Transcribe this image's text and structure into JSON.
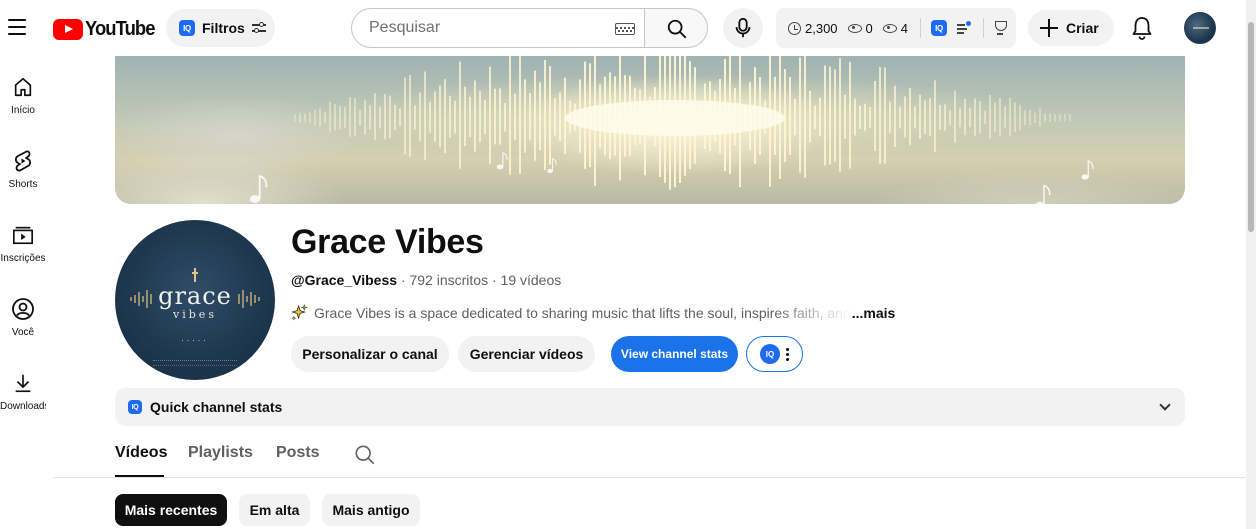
{
  "header": {
    "logo_text": "YouTube",
    "filters_label": "Filtros",
    "search_placeholder": "Pesquisar",
    "ext": {
      "iq": "IQ",
      "views_total": "2,300",
      "views_a": "0",
      "views_b": "4"
    },
    "create_label": "Criar"
  },
  "sidebar": {
    "items": [
      {
        "label": "Início",
        "icon": "home-icon"
      },
      {
        "label": "Shorts",
        "icon": "shorts-icon"
      },
      {
        "label": "Inscrições",
        "icon": "subscriptions-icon"
      },
      {
        "label": "Você",
        "icon": "you-icon"
      },
      {
        "label": "Downloads",
        "icon": "download-icon"
      }
    ]
  },
  "channel": {
    "avatar_word1": "grace",
    "avatar_word2": "vibes",
    "avatar_dots": ".....",
    "name": "Grace Vibes",
    "handle": "@Grace_Vibess",
    "subscribers": "792 inscritos",
    "videos": "19 vídeos",
    "meta_sep": " · ",
    "description": "Grace Vibes is a space dedicated to sharing music that lifts the soul, inspires faith, and",
    "more_label": "...mais",
    "buttons": {
      "customize": "Personalizar o canal",
      "manage": "Gerenciar vídeos",
      "stats": "View channel stats",
      "iq": "IQ"
    },
    "quick_stats_label": "Quick channel stats"
  },
  "tabs": [
    "Vídeos",
    "Playlists",
    "Posts"
  ],
  "chips": [
    "Mais recentes",
    "Em alta",
    "Mais antigo"
  ],
  "colors": {
    "brand_red": "#ff0000",
    "accent_blue": "#1a73e8",
    "iq_blue": "#1f6bf0"
  }
}
